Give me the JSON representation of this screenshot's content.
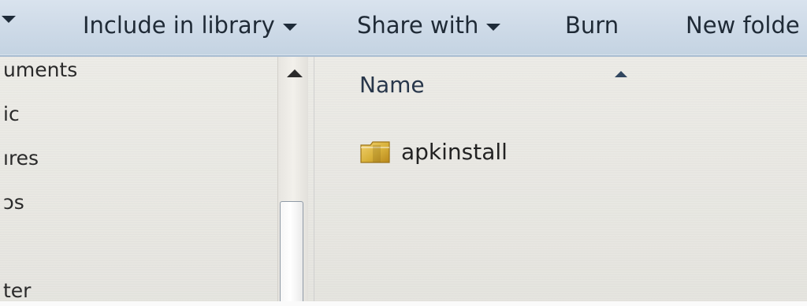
{
  "toolbar": {
    "include_in_library": "Include in library",
    "share_with": "Share with",
    "burn": "Burn",
    "new_folder": "New folde"
  },
  "nav": {
    "items": [
      {
        "label": "uments"
      },
      {
        "label": "ic"
      },
      {
        "label": "ıres"
      },
      {
        "label": "ɔs"
      },
      {
        "label": "ter"
      }
    ]
  },
  "main": {
    "column_header_name": "Name",
    "files": [
      {
        "name": "apkinstall",
        "type": "folder"
      }
    ]
  },
  "icons": {
    "toolbar_left_caret": "chevron-down-icon",
    "toolbar_caret": "chevron-down-icon",
    "nav_scroll_up": "scroll-up-arrow-icon",
    "sort_arrow": "sort-up-icon",
    "folder": "folder-icon"
  },
  "colors": {
    "toolbar_bg": "#cfdbe8",
    "toolbar_text": "#1f2a36",
    "header_text": "#27364a",
    "folder_yellow": "#d8b13a"
  }
}
